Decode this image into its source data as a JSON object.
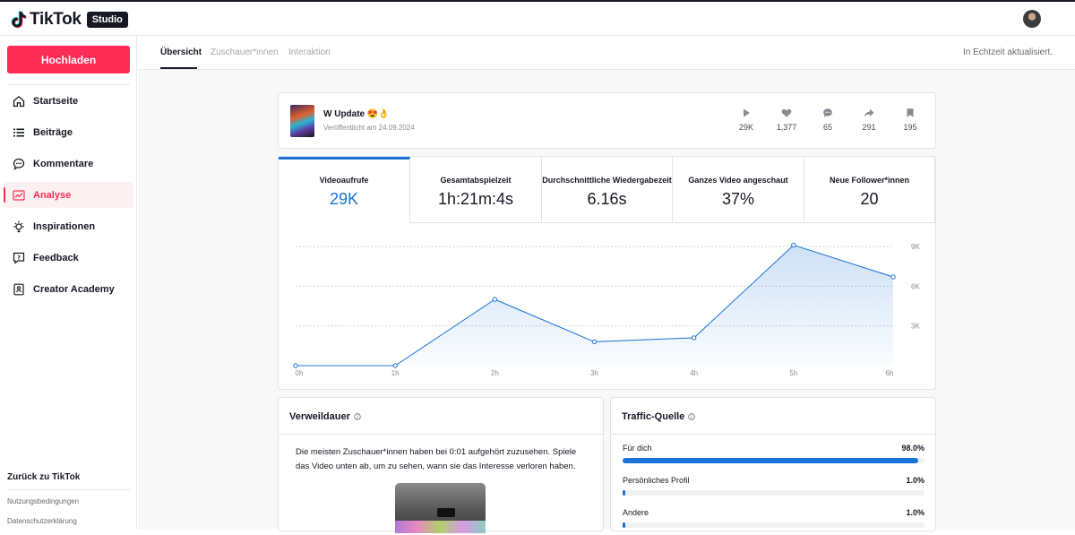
{
  "app": {
    "logo_text": "TikTok",
    "badge": "Studio"
  },
  "sidebar": {
    "upload_label": "Hochladen",
    "items": [
      {
        "label": "Startseite",
        "icon": "home-icon"
      },
      {
        "label": "Beiträge",
        "icon": "list-icon"
      },
      {
        "label": "Kommentare",
        "icon": "comment-icon"
      },
      {
        "label": "Analyse",
        "icon": "analytics-icon",
        "active": true
      },
      {
        "label": "Inspirationen",
        "icon": "lightbulb-icon"
      },
      {
        "label": "Feedback",
        "icon": "feedback-icon"
      },
      {
        "label": "Creator Academy",
        "icon": "academy-icon"
      }
    ],
    "back_link": "Zurück zu TikTok",
    "footer_links": [
      "Nutzungsbedingungen",
      "Datenschutzerklärung"
    ]
  },
  "tabs": {
    "items": [
      "Übersicht",
      "Zuschauer*innen",
      "Interaktion"
    ],
    "active": "Übersicht",
    "realtime_note": "In Echtzeit aktualisiert."
  },
  "video": {
    "title": "W Update 😍👌",
    "published": "Veröffentlicht am 24.09.2024",
    "stats": {
      "views": "29K",
      "likes": "1,377",
      "comments": "65",
      "shares": "291",
      "saves": "195"
    }
  },
  "metrics": [
    {
      "label": "Videoaufrufe",
      "value": "29K",
      "active": true
    },
    {
      "label": "Gesamtabspielzeit",
      "value": "1h:21m:4s"
    },
    {
      "label": "Durchschnittliche Wiedergabezeit",
      "value": "6.16s"
    },
    {
      "label": "Ganzes Video angeschaut",
      "value": "37%"
    },
    {
      "label": "Neue Follower*innen",
      "value": "20"
    }
  ],
  "chart_data": {
    "type": "area",
    "x": [
      "0h",
      "1h",
      "2h",
      "3h",
      "4h",
      "5h",
      "6h"
    ],
    "series": [
      {
        "values": [
          0,
          0,
          5000,
          1800,
          2100,
          9100,
          6700
        ]
      }
    ],
    "yticks": [
      "9K",
      "6K",
      "3K"
    ],
    "ylim": [
      0,
      9000
    ],
    "color": "#1a73d6",
    "grid": true
  },
  "dwell": {
    "title": "Verweildauer",
    "text": "Die meisten Zuschauer*innen haben bei 0:01 aufgehört zuzusehen. Spiele das Video unten ab, um zu sehen, wann sie das Interesse verloren haben."
  },
  "traffic": {
    "title": "Traffic-Quelle",
    "rows": [
      {
        "label": "Für dich",
        "value": "98.0%",
        "pct": 98.0
      },
      {
        "label": "Persönliches Profil",
        "value": "1.0%",
        "pct": 1.0
      },
      {
        "label": "Andere",
        "value": "1.0%",
        "pct": 1.0
      }
    ]
  }
}
